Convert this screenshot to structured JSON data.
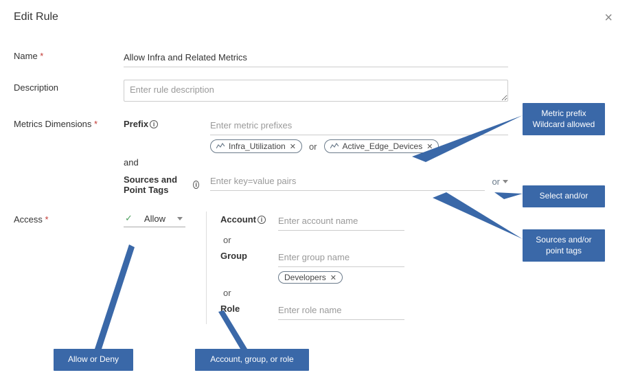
{
  "dialog": {
    "title": "Edit Rule"
  },
  "name": {
    "label": "Name",
    "value": "Allow Infra and Related Metrics"
  },
  "description": {
    "label": "Description",
    "placeholder": "Enter rule description"
  },
  "metrics": {
    "label": "Metrics Dimensions",
    "prefix_label": "Prefix",
    "prefix_placeholder": "Enter metric prefixes",
    "chips": [
      "Infra_Utilization",
      "Active_Edge_Devices"
    ],
    "or_text": "or",
    "and_text": "and",
    "tags_label": "Sources and Point Tags",
    "tags_placeholder": "Enter key=value pairs",
    "andor_value": "or"
  },
  "access": {
    "label": "Access",
    "allow_value": "Allow",
    "account_label": "Account",
    "account_placeholder": "Enter account name",
    "or_text": "or",
    "group_label": "Group",
    "group_placeholder": "Enter group name",
    "group_chips": [
      "Developers"
    ],
    "role_label": "Role",
    "role_placeholder": "Enter role name"
  },
  "callouts": {
    "prefix_1": "Metric prefix",
    "prefix_2": "Wildcard allowed",
    "andor": "Select and/or",
    "tags_1": "Sources and/or",
    "tags_2": "point tags",
    "allow": "Allow or Deny",
    "account": "Account, group, or role"
  }
}
